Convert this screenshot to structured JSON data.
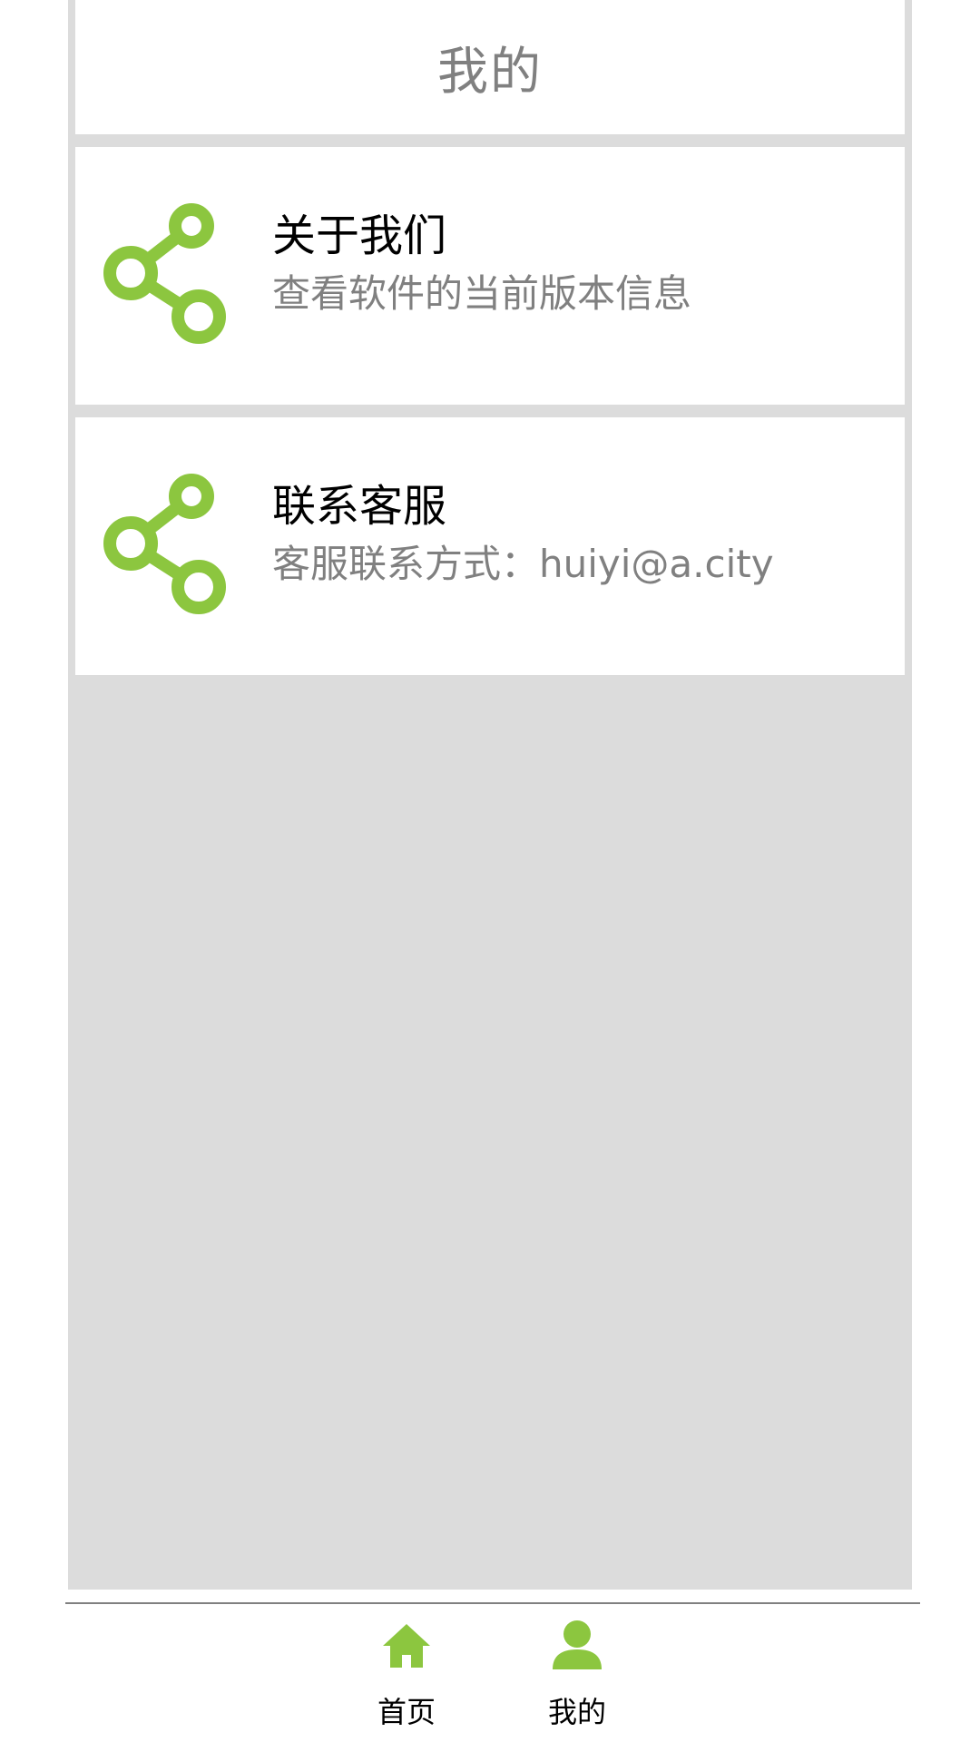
{
  "header": {
    "title": "我的"
  },
  "menu": {
    "items": [
      {
        "title": "关于我们",
        "subtitle": "查看软件的当前版本信息",
        "icon": "share-icon"
      },
      {
        "title": "联系客服",
        "subtitle": "客服联系方式：huiyi@a.city",
        "icon": "share-icon"
      }
    ]
  },
  "bottom_nav": {
    "tabs": [
      {
        "label": "首页",
        "icon": "home-icon"
      },
      {
        "label": "我的",
        "icon": "user-icon"
      }
    ]
  },
  "colors": {
    "accent": "#8cc63f",
    "background": "#dcdcdc",
    "title_text": "#000000",
    "secondary_text": "#808080"
  }
}
